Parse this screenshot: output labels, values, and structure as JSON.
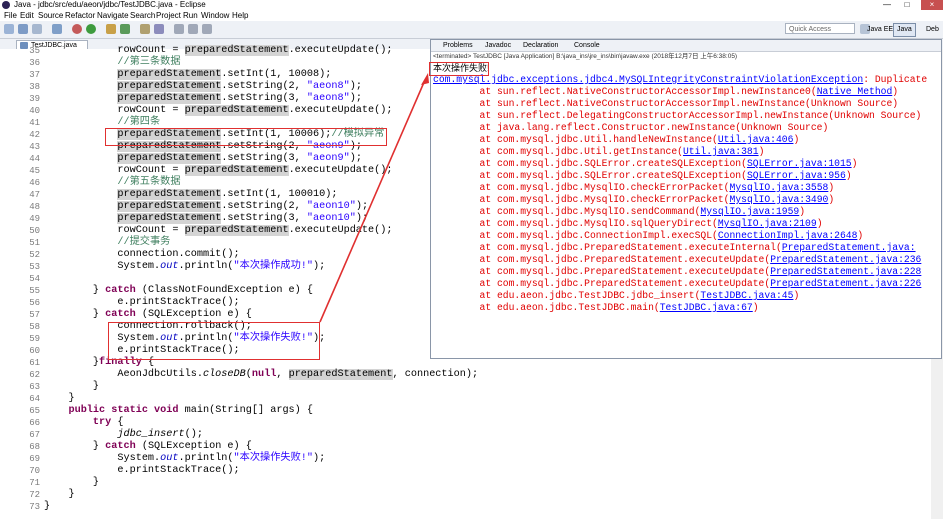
{
  "window": {
    "title": "Java - jdbc/src/edu/aeon/jdbc/TestJDBC.java - Eclipse",
    "min": "—",
    "max": "□",
    "close": "×"
  },
  "menu": [
    "File",
    "Edit",
    "Source",
    "Refactor",
    "Navigate",
    "Search",
    "Project",
    "Run",
    "Window",
    "Help"
  ],
  "quick_access_placeholder": "Quick Access",
  "perspectives": [
    "Java EE",
    "Java",
    "Deb"
  ],
  "editor_tab": "TestJDBC.java",
  "code_lines": [
    {
      "n": "35",
      "html": "            rowCount = <span class='hl'>preparedStatement</span>.executeUpdate();"
    },
    {
      "n": "36",
      "html": "            <span class='com'>//第三条数据</span>"
    },
    {
      "n": "37",
      "html": "            <span class='hl'>preparedStatement</span>.setInt(1, 10008);"
    },
    {
      "n": "38",
      "html": "            <span class='hl'>preparedStatement</span>.setString(2, <span class='str'>\"aeon8\"</span>);"
    },
    {
      "n": "39",
      "html": "            <span class='hl'>preparedStatement</span>.setString(3, <span class='str'>\"aeon8\"</span>);"
    },
    {
      "n": "40",
      "html": "            rowCount = <span class='hl'>preparedStatement</span>.executeUpdate();"
    },
    {
      "n": "41",
      "html": "            <span class='com'>//第四条</span>"
    },
    {
      "n": "42",
      "html": "            <span class='hl'>preparedStatement</span>.setInt(1, 10006);<span class='com'>//模拟异常</span>"
    },
    {
      "n": "43",
      "html": "            <span class='hl'>preparedStatement</span>.setString(2, <span class='str'>\"aeon9\"</span>);"
    },
    {
      "n": "44",
      "html": "            <span class='hl'>preparedStatement</span>.setString(3, <span class='str'>\"aeon9\"</span>);"
    },
    {
      "n": "45",
      "html": "            rowCount = <span class='hl'>preparedStatement</span>.executeUpdate();"
    },
    {
      "n": "46",
      "html": "            <span class='com'>//第五条数据</span>"
    },
    {
      "n": "47",
      "html": "            <span class='hl'>preparedStatement</span>.setInt(1, 100010);"
    },
    {
      "n": "48",
      "html": "            <span class='hl'>preparedStatement</span>.setString(2, <span class='str'>\"aeon10\"</span>);"
    },
    {
      "n": "49",
      "html": "            <span class='hl'>preparedStatement</span>.setString(3, <span class='str'>\"aeon10\"</span>);"
    },
    {
      "n": "50",
      "html": "            rowCount = <span class='hl'>preparedStatement</span>.executeUpdate();"
    },
    {
      "n": "51",
      "html": "            <span class='com'>//提交事务</span>"
    },
    {
      "n": "52",
      "html": "            connection.commit();"
    },
    {
      "n": "53",
      "html": "            System.<span class='fld it'>out</span>.println(<span class='str'>\"本次操作成功!\"</span>);"
    },
    {
      "n": "54",
      "html": ""
    },
    {
      "n": "55",
      "html": "        } <span class='kw'>catch</span> (ClassNotFoundException e) {"
    },
    {
      "n": "56",
      "html": "            e.printStackTrace();"
    },
    {
      "n": "57",
      "html": "        } <span class='kw'>catch</span> (SQLException e) {"
    },
    {
      "n": "58",
      "html": "            connection.rollback();"
    },
    {
      "n": "59",
      "html": "            System.<span class='fld it'>out</span>.println(<span class='str'>\"本次操作失败!\"</span>);"
    },
    {
      "n": "60",
      "html": "            e.printStackTrace();"
    },
    {
      "n": "61",
      "html": "        }<span class='kw'>finally</span> {"
    },
    {
      "n": "62",
      "html": "            AeonJdbcUtils.<span class='it'>closeDB</span>(<span class='kw'>null</span>, <span class='hl'>preparedStatement</span>, connection);"
    },
    {
      "n": "63",
      "html": "        }"
    },
    {
      "n": "64",
      "html": "    }"
    },
    {
      "n": "65",
      "html": "    <span class='kw'>public static void</span> main(String[] args) {"
    },
    {
      "n": "66",
      "html": "        <span class='kw'>try</span> {"
    },
    {
      "n": "67",
      "html": "            <span class='it'>jdbc_insert</span>();"
    },
    {
      "n": "68",
      "html": "        } <span class='kw'>catch</span> (SQLException e) {"
    },
    {
      "n": "69",
      "html": "            System.<span class='fld it'>out</span>.println(<span class='str'>\"本次操作失败!\"</span>);"
    },
    {
      "n": "70",
      "html": "            e.printStackTrace();"
    },
    {
      "n": "71",
      "html": "        }"
    },
    {
      "n": "72",
      "html": "    }"
    },
    {
      "n": "73",
      "html": "}"
    }
  ],
  "console": {
    "tabs": [
      "Problems",
      "Javadoc",
      "Declaration",
      "Console"
    ],
    "status": "<terminated> TestJDBC [Java Application] B:\\java_ins\\jre_ins\\bin\\javaw.exe (2018年12月7日 上午6:38:05)",
    "lines": [
      {
        "cls": "black",
        "html": "本次操作失败!"
      },
      {
        "cls": "",
        "html": "<span class='lnk'>com.mysql.jdbc.exceptions.jdbc4.MySQLIntegrityConstraintViolationException</span>: Duplicate"
      },
      {
        "cls": "",
        "html": "        at sun.reflect.NativeConstructorAccessorImpl.newInstance0(<span class='lnk'>Native Method</span>)"
      },
      {
        "cls": "",
        "html": "        at sun.reflect.NativeConstructorAccessorImpl.newInstance(Unknown Source)"
      },
      {
        "cls": "",
        "html": "        at sun.reflect.DelegatingConstructorAccessorImpl.newInstance(Unknown Source)"
      },
      {
        "cls": "",
        "html": "        at java.lang.reflect.Constructor.newInstance(Unknown Source)"
      },
      {
        "cls": "",
        "html": "        at com.mysql.jdbc.Util.handleNewInstance(<span class='lnk'>Util.java:406</span>)"
      },
      {
        "cls": "",
        "html": "        at com.mysql.jdbc.Util.getInstance(<span class='lnk'>Util.java:381</span>)"
      },
      {
        "cls": "",
        "html": "        at com.mysql.jdbc.SQLError.createSQLException(<span class='lnk'>SQLError.java:1015</span>)"
      },
      {
        "cls": "",
        "html": "        at com.mysql.jdbc.SQLError.createSQLException(<span class='lnk'>SQLError.java:956</span>)"
      },
      {
        "cls": "",
        "html": "        at com.mysql.jdbc.MysqlIO.checkErrorPacket(<span class='lnk'>MysqlIO.java:3558</span>)"
      },
      {
        "cls": "",
        "html": "        at com.mysql.jdbc.MysqlIO.checkErrorPacket(<span class='lnk'>MysqlIO.java:3490</span>)"
      },
      {
        "cls": "",
        "html": "        at com.mysql.jdbc.MysqlIO.sendCommand(<span class='lnk'>MysqlIO.java:1959</span>)"
      },
      {
        "cls": "",
        "html": "        at com.mysql.jdbc.MysqlIO.sqlQueryDirect(<span class='lnk'>MysqlIO.java:2109</span>)"
      },
      {
        "cls": "",
        "html": "        at com.mysql.jdbc.ConnectionImpl.execSQL(<span class='lnk'>ConnectionImpl.java:2648</span>)"
      },
      {
        "cls": "",
        "html": "        at com.mysql.jdbc.PreparedStatement.executeInternal(<span class='lnk'>PreparedStatement.java:</span>"
      },
      {
        "cls": "",
        "html": "        at com.mysql.jdbc.PreparedStatement.executeUpdate(<span class='lnk'>PreparedStatement.java:236</span>"
      },
      {
        "cls": "",
        "html": "        at com.mysql.jdbc.PreparedStatement.executeUpdate(<span class='lnk'>PreparedStatement.java:228</span>"
      },
      {
        "cls": "",
        "html": "        at com.mysql.jdbc.PreparedStatement.executeUpdate(<span class='lnk'>PreparedStatement.java:226</span>"
      },
      {
        "cls": "",
        "html": "        at edu.aeon.jdbc.TestJDBC.jdbc_insert(<span class='lnk'>TestJDBC.java:45</span>)"
      },
      {
        "cls": "",
        "html": "        at edu.aeon.jdbc.TestJDBC.main(<span class='lnk'>TestJDBC.java:67</span>)"
      }
    ]
  }
}
